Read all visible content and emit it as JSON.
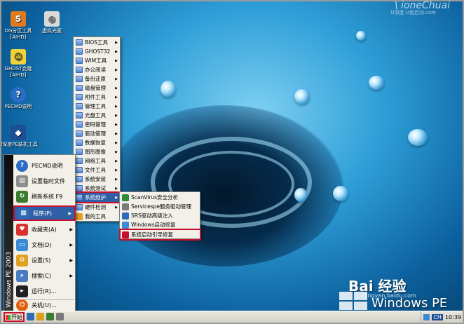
{
  "watermark": {
    "brand": "\\ ioneChuai",
    "sub": "U深度 U盘启动.com"
  },
  "desktop_icons": [
    {
      "label": "DG分区工具 [AIHD]",
      "icon": "partition-icon",
      "color": "#e07a1d"
    },
    {
      "label": "虚拟光驱",
      "icon": "virtual-drive-icon",
      "color": "#d9d9d9"
    },
    {
      "label": "GHOST克隆 [AIHD]",
      "icon": "ghost-icon",
      "color": "#f0d23a"
    },
    {
      "label": "PECMD说明",
      "icon": "help-icon",
      "color": "#2b6cc4"
    },
    {
      "label": "U深度PE装机工具",
      "icon": "installer-icon",
      "color": "#1e4f95"
    }
  ],
  "start_menu": {
    "sidebar_label": "Windows PE 2003",
    "items": [
      {
        "label": "PECMD说明",
        "color": "#2b6cc4",
        "glyph": "?"
      },
      {
        "label": "设置临时文件",
        "color": "#8d8d8d",
        "glyph": "▤"
      },
      {
        "label": "刷新系统 F9",
        "color": "#3b7b2e",
        "glyph": "↻"
      },
      {
        "label": "程序(P)",
        "color": "#2f6ab8",
        "glyph": "▦",
        "arrow": "▶"
      },
      {
        "label": "收藏夹(A)",
        "color": "#d8322c",
        "glyph": "♥",
        "arrow": "▶"
      },
      {
        "label": "文档(D)",
        "color": "#3a8ad6",
        "glyph": "▭",
        "arrow": "▶"
      },
      {
        "label": "设置(S)",
        "color": "#e0a020",
        "glyph": "⚙",
        "arrow": "▶"
      },
      {
        "label": "搜索(C)",
        "color": "#4a7bc0",
        "glyph": "⌕",
        "arrow": "▶"
      },
      {
        "label": "运行(R)...",
        "color": "#202020",
        "glyph": "▸"
      },
      {
        "label": "关机(U)...",
        "color": "#e06010",
        "glyph": "⏻"
      }
    ]
  },
  "programs_menu": {
    "items": [
      {
        "label": "BIOS工具",
        "arrow": "▶"
      },
      {
        "label": "GHOST32",
        "arrow": "▶"
      },
      {
        "label": "WIM工具",
        "arrow": "▶"
      },
      {
        "label": "办公阅读",
        "arrow": "▶"
      },
      {
        "label": "备份还原",
        "arrow": "▶"
      },
      {
        "label": "磁盘管理",
        "arrow": "▶"
      },
      {
        "label": "附件工具",
        "arrow": "▶"
      },
      {
        "label": "管理工具",
        "arrow": "▶"
      },
      {
        "label": "光盘工具",
        "arrow": "▶"
      },
      {
        "label": "密码管理",
        "arrow": "▶"
      },
      {
        "label": "驱动管理",
        "arrow": "▶"
      },
      {
        "label": "数据恢复",
        "arrow": "▶"
      },
      {
        "label": "图形图像",
        "arrow": "▶"
      },
      {
        "label": "网络工具",
        "arrow": "▶"
      },
      {
        "label": "文件工具",
        "arrow": "▶"
      },
      {
        "label": "系统安装",
        "arrow": "▶"
      },
      {
        "label": "系统测试",
        "arrow": "▶"
      },
      {
        "label": "系统维护",
        "arrow": "▶"
      },
      {
        "label": "硬件检测",
        "arrow": "▶"
      },
      {
        "label": "我的工具",
        "arrow": ""
      }
    ]
  },
  "maintenance_menu": {
    "items": [
      {
        "label": "ScanVirus安全分析",
        "color": "#2e8b3a"
      },
      {
        "label": "Servicespe服务驱动管理",
        "color": "#7a7a7a"
      },
      {
        "label": "SRS驱动高级注入",
        "color": "#2f6ab8"
      },
      {
        "label": "Windows启动修复",
        "color": "#3a8ad6"
      },
      {
        "label": "系统启动引导修复",
        "color": "#c8102e"
      }
    ]
  },
  "taskbar": {
    "start_label": "开始",
    "tray_lang": "CH",
    "clock": "10:39"
  },
  "baidu": {
    "logo": "Bai 经验",
    "sub": "jingyan.baidu.com",
    "product": "Windows PE"
  }
}
